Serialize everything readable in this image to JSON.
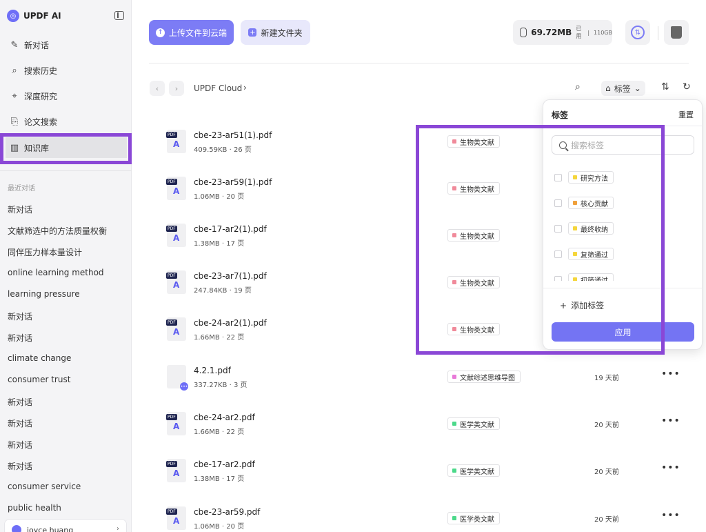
{
  "sidebar": {
    "brand": "UPDF AI",
    "nav": [
      {
        "label": "新对话",
        "icon": "edit-icon"
      },
      {
        "label": "搜索历史",
        "icon": "search-icon"
      },
      {
        "label": "深度研究",
        "icon": "telescope-icon"
      },
      {
        "label": "论文搜索",
        "icon": "doc-search-icon"
      },
      {
        "label": "知识库",
        "icon": "library-icon"
      }
    ],
    "recent_title": "最近对话",
    "recent": [
      "新对话",
      "文献筛选中的方法质量权衡",
      "同伴压力样本量设计",
      "online learning method",
      "learning pressure",
      "新对话",
      "新对话",
      "climate change",
      "consumer trust",
      "新对话",
      "新对话",
      "新对话",
      "新对话",
      "consumer service",
      "public health"
    ],
    "user_name": "joyce huang"
  },
  "toolbar": {
    "upload_label": "上传文件到云端",
    "new_folder_label": "新建文件夹",
    "storage_used": "69.72MB",
    "storage_used_label": "已用",
    "storage_sep": "|",
    "storage_total": "110GB"
  },
  "breadcrumb": {
    "root": "UPDF Cloud",
    "tag_filter_label": "标签"
  },
  "files": [
    {
      "name": "cbe-23-ar51(1).pdf",
      "meta": "409.59KB · 26 页",
      "tag": "生物类文献",
      "tag_color": "#f08a9a",
      "date": "",
      "type": "pdf"
    },
    {
      "name": "cbe-23-ar59(1).pdf",
      "meta": "1.06MB · 20 页",
      "tag": "生物类文献",
      "tag_color": "#f08a9a",
      "date": "",
      "type": "pdf"
    },
    {
      "name": "cbe-17-ar2(1).pdf",
      "meta": "1.38MB · 17 页",
      "tag": "生物类文献",
      "tag_color": "#f08a9a",
      "date": "",
      "type": "pdf"
    },
    {
      "name": "cbe-23-ar7(1).pdf",
      "meta": "247.84KB · 19 页",
      "tag": "生物类文献",
      "tag_color": "#f08a9a",
      "date": "",
      "type": "pdf"
    },
    {
      "name": "cbe-24-ar2(1).pdf",
      "meta": "1.66MB · 22 页",
      "tag": "生物类文献",
      "tag_color": "#f08a9a",
      "date": "",
      "type": "pdf"
    },
    {
      "name": "4.2.1.pdf",
      "meta": "337.27KB · 3 页",
      "tag": "文献综述思维导图",
      "tag_color": "#e87ad8",
      "date": "19 天前",
      "type": "doc"
    },
    {
      "name": "cbe-24-ar2.pdf",
      "meta": "1.66MB · 22 页",
      "tag": "医学类文献",
      "tag_color": "#4cd98a",
      "date": "20 天前",
      "type": "pdf"
    },
    {
      "name": "cbe-17-ar2.pdf",
      "meta": "1.38MB · 17 页",
      "tag": "医学类文献",
      "tag_color": "#4cd98a",
      "date": "20 天前",
      "type": "pdf"
    },
    {
      "name": "cbe-23-ar59.pdf",
      "meta": "1.06MB · 20 页",
      "tag": "医学类文献",
      "tag_color": "#4cd98a",
      "date": "20 天前",
      "type": "pdf"
    }
  ],
  "tag_panel": {
    "title": "标签",
    "reset_label": "重置",
    "search_placeholder": "搜索标签",
    "options": [
      {
        "label": "研究方法",
        "color": "#f5d63c"
      },
      {
        "label": "核心贡献",
        "color": "#f0a13c"
      },
      {
        "label": "最终收纳",
        "color": "#f5d63c"
      },
      {
        "label": "复筛通过",
        "color": "#f5d63c"
      },
      {
        "label": "初筛通过",
        "color": "#f5d63c"
      }
    ],
    "add_label": "添加标签",
    "apply_label": "应用"
  },
  "icons": {
    "file_badge": "PDF",
    "more": "•••"
  }
}
